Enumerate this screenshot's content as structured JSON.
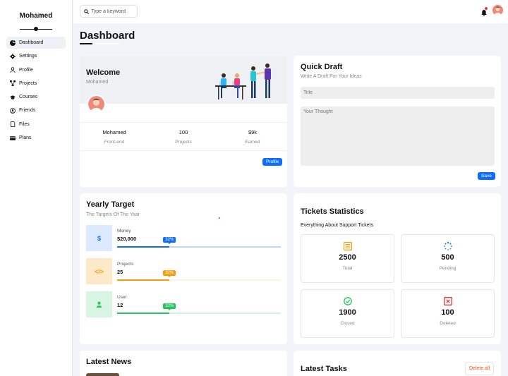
{
  "sidebar": {
    "brand": "Mohamed",
    "items": [
      {
        "label": "Dashboard",
        "icon": "dashboard-icon",
        "active": true
      },
      {
        "label": "Settings",
        "icon": "gear-icon"
      },
      {
        "label": "Profile",
        "icon": "user-icon"
      },
      {
        "label": "Projects",
        "icon": "diagram-icon"
      },
      {
        "label": "Courses",
        "icon": "graduation-cap-icon"
      },
      {
        "label": "Friends",
        "icon": "user-circle-icon"
      },
      {
        "label": "Files",
        "icon": "file-icon"
      },
      {
        "label": "Plans",
        "icon": "credit-card-icon"
      }
    ]
  },
  "topbar": {
    "search_placeholder": "Type a keyword",
    "notification_icon": "bell-icon",
    "avatar_icon": "avatar-icon"
  },
  "page": {
    "title": "Dashboard"
  },
  "welcome": {
    "title": "Welcome",
    "name": "Mohamed",
    "stats": [
      {
        "value": "Mohamed",
        "label": "Front-end"
      },
      {
        "value": "100",
        "label": "Projects"
      },
      {
        "value": "$9k",
        "label": "Earned"
      }
    ],
    "button": "Profile"
  },
  "draft": {
    "title": "Quick Draft",
    "subtitle": "Write A Draft For Your Ideas",
    "title_placeholder": "Title",
    "body_placeholder": "Your Thought",
    "button": "Save"
  },
  "target": {
    "title": "Yearly Target",
    "subtitle": "The Targets Of The Year",
    "rows": [
      {
        "label": "Money",
        "value": "$20,000",
        "percent_label": "32%",
        "progress": 0.32,
        "icon": "dollar-icon",
        "icon_text": "$",
        "color": "#0d6efd",
        "bg": "#dbeafe",
        "track": "#bfd6f6"
      },
      {
        "label": "Projects",
        "value": "25",
        "percent_label": "32%",
        "progress": 0.32,
        "icon": "code-icon",
        "icon_text": "</>",
        "color": "#f59e0b",
        "bg": "#fde9c8",
        "track": "#fdf3e1"
      },
      {
        "label": "User",
        "value": "12",
        "percent_label": "32%",
        "progress": 0.32,
        "icon": "user-icon",
        "icon_text": "",
        "color": "#22c55e",
        "bg": "#d7f5e2",
        "track": "#d2f2dd"
      }
    ]
  },
  "tickets": {
    "title": "Tickets Statistics",
    "subtitle": "Everything About Support Tickets",
    "items": [
      {
        "value": "2500",
        "label": "Total",
        "icon": "list-icon",
        "color": "#f59e0b"
      },
      {
        "value": "500",
        "label": "Pending",
        "icon": "spinner-icon",
        "color": "#0d6efd"
      },
      {
        "value": "1900",
        "label": "Closed",
        "icon": "check-circle-icon",
        "color": "#22c55e"
      },
      {
        "value": "100",
        "label": "Deleted",
        "icon": "close-box-icon",
        "color": "#e53935"
      }
    ]
  },
  "news": {
    "title": "Latest News"
  },
  "tasks": {
    "title": "Latest Tasks",
    "button": "Delete all"
  }
}
